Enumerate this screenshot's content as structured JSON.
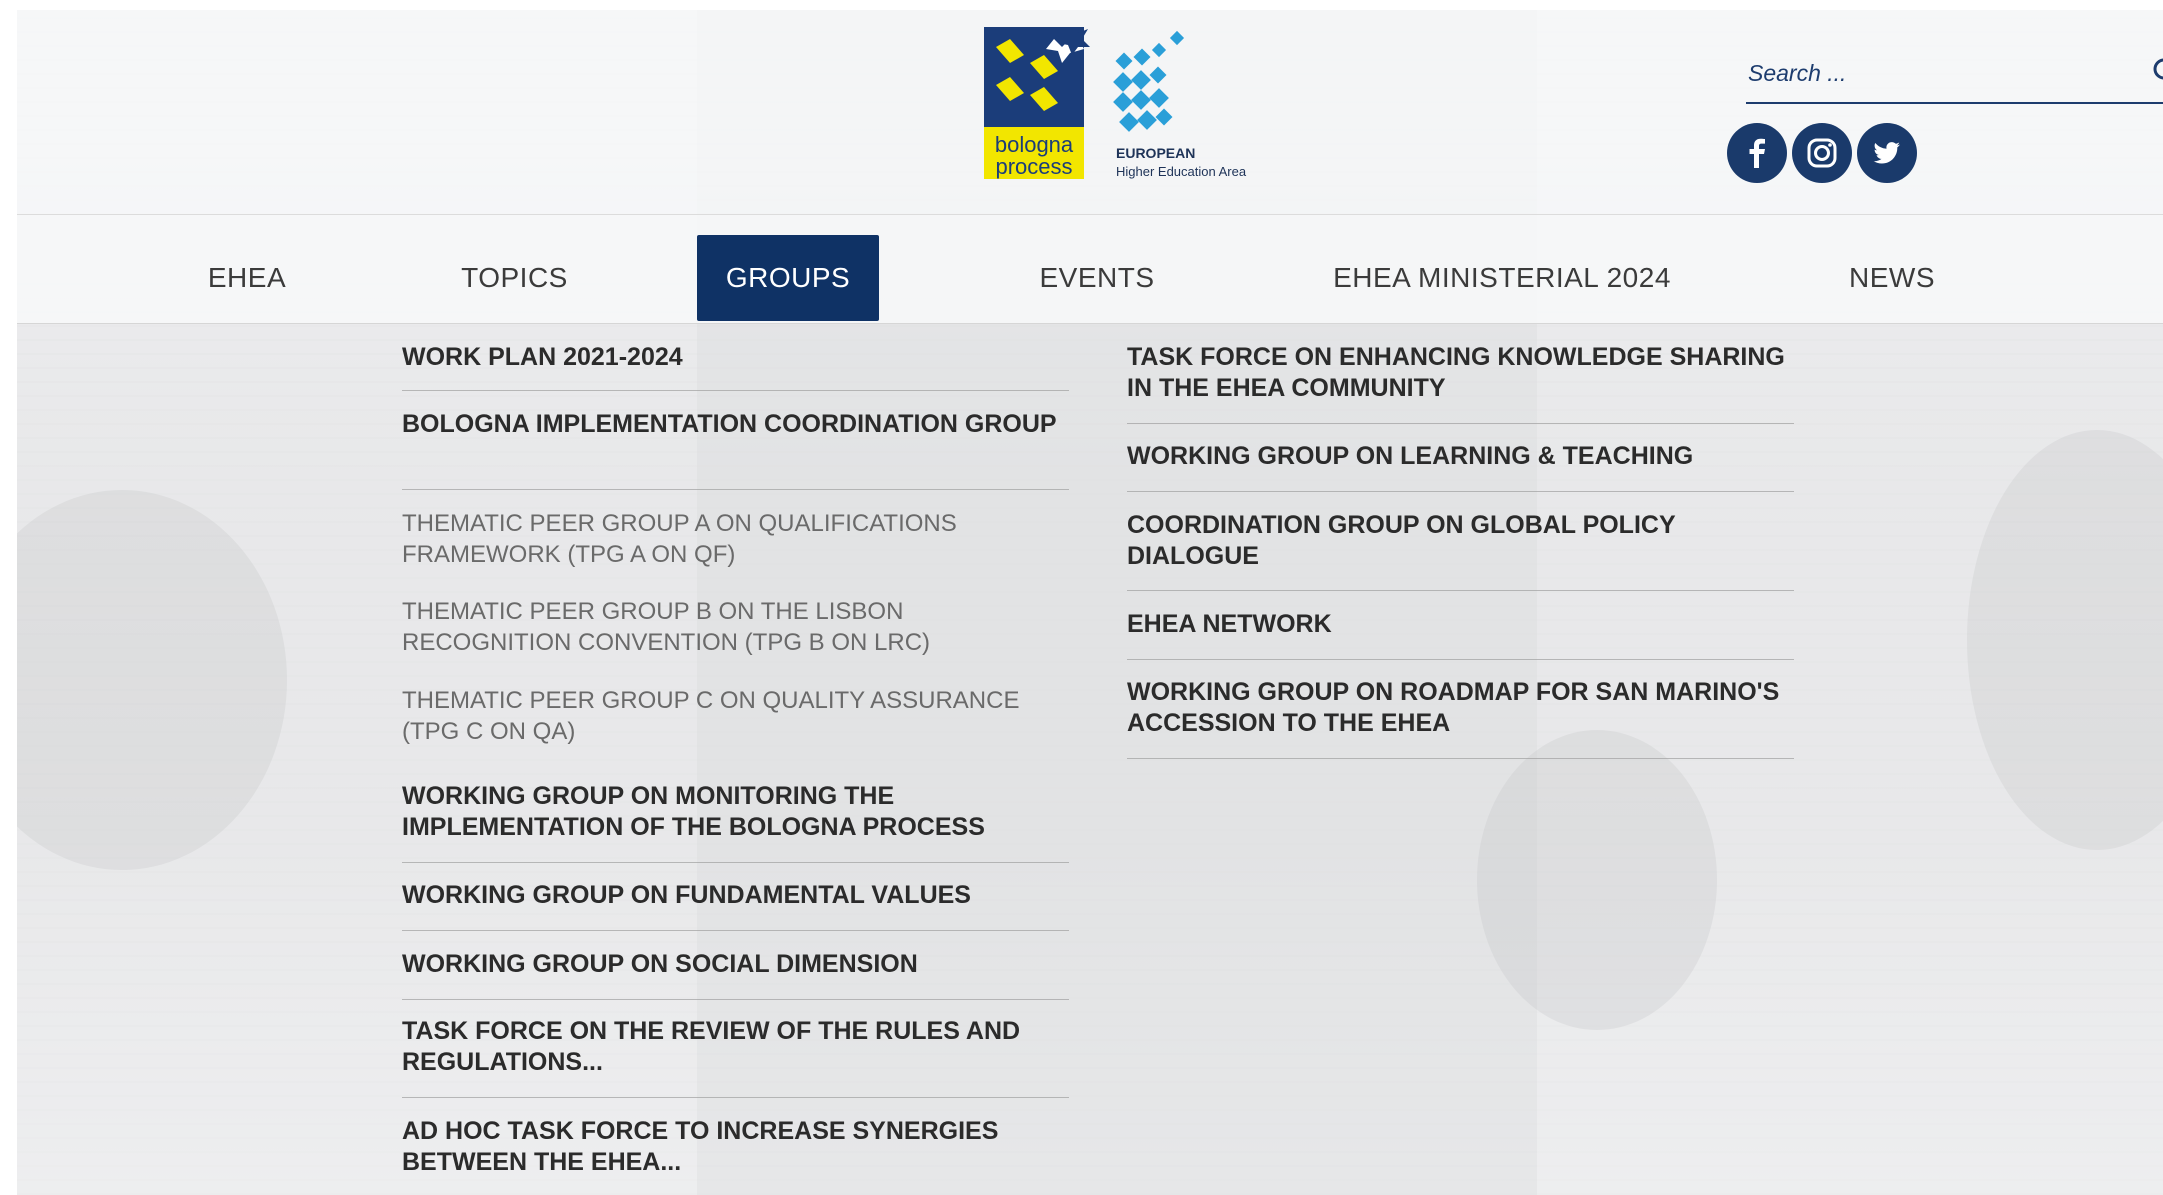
{
  "header": {
    "logo": {
      "bp_line1": "bologna",
      "bp_line2": "process",
      "ehea_line1": "EUROPEAN",
      "ehea_line2": "Higher Education Area"
    },
    "search": {
      "placeholder": "Search ..."
    },
    "social": [
      {
        "name": "facebook",
        "icon": "facebook-icon"
      },
      {
        "name": "instagram",
        "icon": "instagram-icon"
      },
      {
        "name": "twitter",
        "icon": "twitter-icon"
      }
    ]
  },
  "nav": {
    "items": [
      {
        "label": "EHEA"
      },
      {
        "label": "TOPICS"
      },
      {
        "label": "GROUPS"
      },
      {
        "label": "EVENTS"
      },
      {
        "label": "EHEA MINISTERIAL 2024"
      },
      {
        "label": "NEWS"
      }
    ],
    "active": "GROUPS"
  },
  "menu": {
    "left": [
      {
        "label": "WORK PLAN 2021-2024"
      },
      {
        "label": "BOLOGNA IMPLEMENTATION COORDINATION GROUP"
      },
      {
        "label": "THEMATIC PEER GROUP A ON QUALIFICATIONS FRAMEWORK (TPG A ON QF)"
      },
      {
        "label": "THEMATIC PEER GROUP B ON THE LISBON RECOGNITION CONVENTION (TPG B ON LRC)"
      },
      {
        "label": "THEMATIC PEER GROUP C ON QUALITY ASSURANCE (TPG C ON QA)"
      },
      {
        "label": "WORKING GROUP ON MONITORING THE IMPLEMENTATION OF THE BOLOGNA PROCESS"
      },
      {
        "label": "WORKING GROUP ON FUNDAMENTAL VALUES"
      },
      {
        "label": "WORKING GROUP ON SOCIAL DIMENSION"
      },
      {
        "label": "TASK FORCE ON THE REVIEW OF THE RULES AND REGULATIONS..."
      },
      {
        "label": "AD HOC TASK FORCE TO INCREASE SYNERGIES BETWEEN THE EHEA..."
      }
    ],
    "right": [
      {
        "label": "TASK FORCE ON ENHANCING KNOWLEDGE SHARING IN THE EHEA COMMUNITY"
      },
      {
        "label": "WORKING GROUP ON LEARNING & TEACHING"
      },
      {
        "label": "COORDINATION GROUP ON GLOBAL POLICY DIALOGUE"
      },
      {
        "label": "EHEA NETWORK"
      },
      {
        "label": "WORKING GROUP ON ROADMAP FOR SAN MARINO'S ACCESSION TO THE EHEA"
      }
    ]
  },
  "colors": {
    "brand_navy": "#0f3265",
    "logo_yellow": "#f2e600",
    "logo_blue": "#2a9fd8",
    "social_bg": "#1a3a6b"
  }
}
